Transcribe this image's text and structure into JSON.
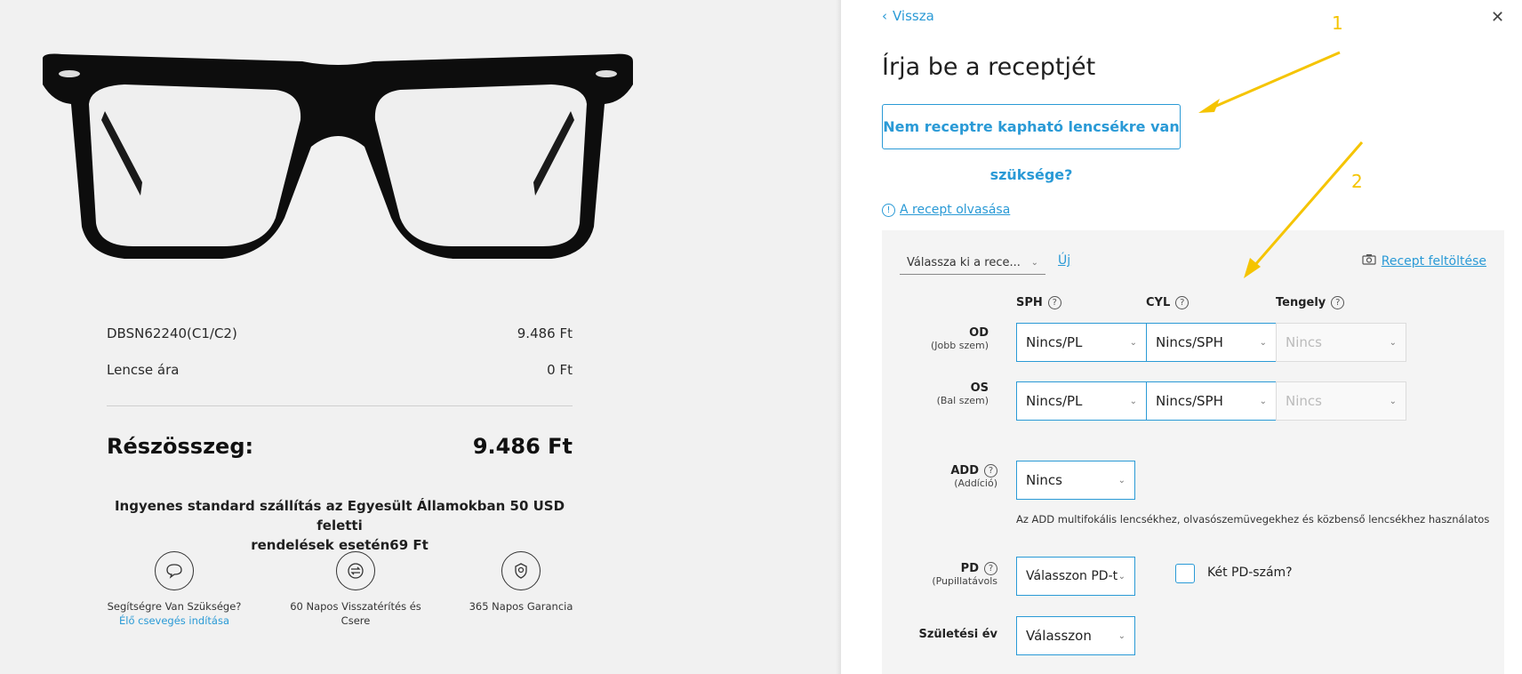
{
  "product": {
    "sku": "DBSN62240(C1/C2)",
    "sku_price": "9.486 Ft",
    "lens_label": "Lencse ára",
    "lens_price": "0 Ft",
    "subtotal_label": "Részösszeg:",
    "subtotal_value": "9.486 Ft",
    "shipping_line1": "Ingyenes standard szállítás az Egyesült Államokban 50 USD feletti",
    "shipping_line2": "rendelések esetén69 Ft"
  },
  "features": [
    {
      "icon": "chat-icon",
      "text": "Segítségre Van Szüksége?",
      "link": "Élő csevegés indítása"
    },
    {
      "icon": "exchange-icon",
      "text": "60 Napos Visszatérítés és Csere"
    },
    {
      "icon": "warranty-icon",
      "text": "365 Napos Garancia"
    }
  ],
  "panel": {
    "back_label": "Vissza",
    "title": "Írja be a receptjét",
    "non_rx_line1": "Nem receptre kapható lencsékre van",
    "non_rx_line2": "szüksége?",
    "read_rx_label": "A recept olvasása",
    "select_rx_label": "Válassza ki a rece...",
    "new_label": "Új",
    "upload_label": "Recept feltöltése"
  },
  "form": {
    "columns": [
      "SPH",
      "CYL",
      "Tengely"
    ],
    "od": {
      "label": "OD",
      "sub": "(Jobb szem)",
      "sph": "Nincs/PL",
      "cyl": "Nincs/SPH",
      "axis": "Nincs"
    },
    "os": {
      "label": "OS",
      "sub": "(Bal szem)",
      "sph": "Nincs/PL",
      "cyl": "Nincs/SPH",
      "axis": "Nincs"
    },
    "add": {
      "label": "ADD",
      "sub": "(Addíció)",
      "value": "Nincs",
      "note": "Az ADD multifokális lencsékhez, olvasószemüvegekhez és közbenső lencsékhez használatos"
    },
    "pd": {
      "label": "PD",
      "sub": "(Pupillatávols",
      "value": "Válasszon PD-t",
      "two_pd_label": "Két PD-szám?"
    },
    "birth": {
      "label": "Születési év",
      "value": "Válasszon"
    }
  },
  "annotations": {
    "one": "1",
    "two": "2"
  }
}
